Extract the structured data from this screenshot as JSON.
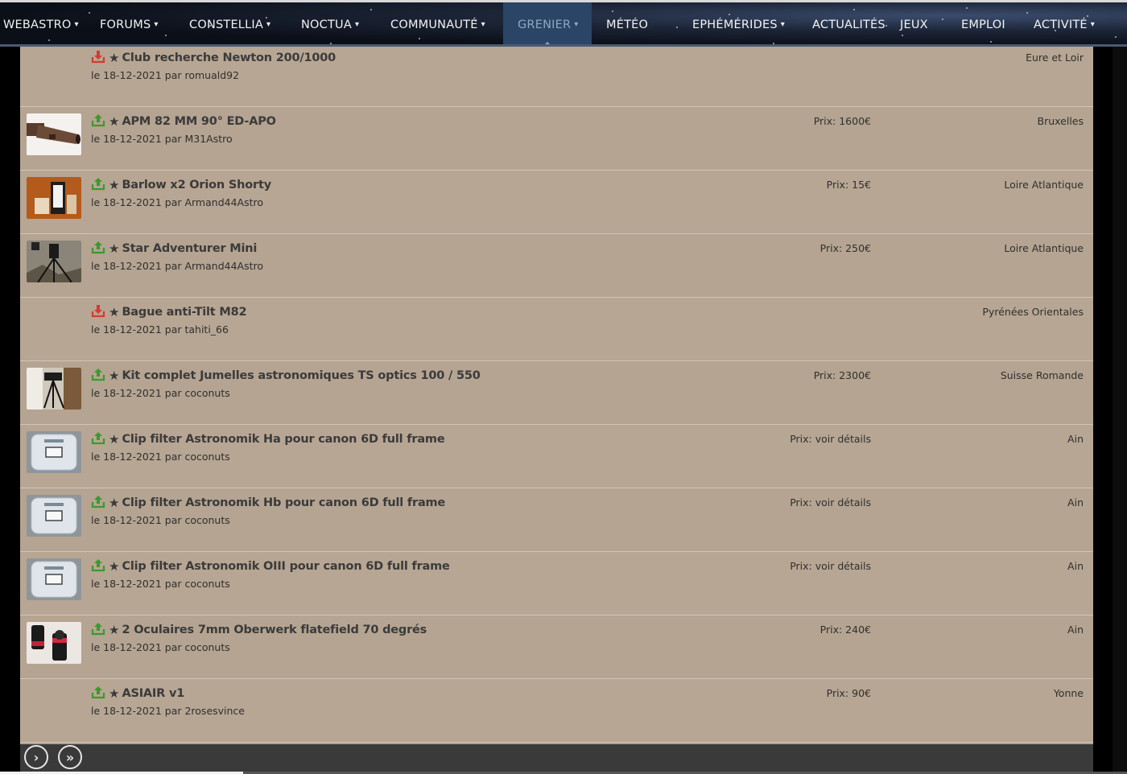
{
  "nav": {
    "items": [
      {
        "label": "WEBASTRO",
        "caret": true,
        "active": false
      },
      {
        "label": "FORUMS",
        "caret": true,
        "active": false
      },
      {
        "label": "CONSTELLIA",
        "caret": true,
        "active": false
      },
      {
        "label": "NOCTUA",
        "caret": true,
        "active": false
      },
      {
        "label": "COMMUNAUTÉ",
        "caret": true,
        "active": false
      },
      {
        "label": "GRENIER",
        "caret": true,
        "active": true
      },
      {
        "label": "MÉTÉO",
        "caret": false,
        "active": false
      },
      {
        "label": "EPHÉMÉRIDES",
        "caret": true,
        "active": false
      },
      {
        "label": "ACTUALITÉS",
        "caret": false,
        "active": false
      },
      {
        "label": "JEUX",
        "caret": false,
        "active": false
      },
      {
        "label": "EMPLOI",
        "caret": false,
        "active": false
      },
      {
        "label": "ACTIVITÉ",
        "caret": true,
        "active": false
      }
    ],
    "caret_glyph": "▾"
  },
  "listings": [
    {
      "kind": "wanted",
      "thumb": "",
      "title": "Club recherche Newton 200/1000",
      "meta": "le 18-12-2021 par romuald92",
      "price": "",
      "location": "Eure et Loir"
    },
    {
      "kind": "offer",
      "thumb": "refractor",
      "title": "APM 82 MM 90° ED-APO",
      "meta": "le 18-12-2021 par M31Astro",
      "price": "Prix: 1600€",
      "location": "Bruxelles"
    },
    {
      "kind": "offer",
      "thumb": "barlow",
      "title": "Barlow x2 Orion Shorty",
      "meta": "le 18-12-2021 par Armand44Astro",
      "price": "Prix: 15€",
      "location": "Loire Atlantique"
    },
    {
      "kind": "offer",
      "thumb": "mount",
      "title": "Star Adventurer Mini",
      "meta": "le 18-12-2021 par Armand44Astro",
      "price": "Prix: 250€",
      "location": "Loire Atlantique"
    },
    {
      "kind": "wanted",
      "thumb": "",
      "title": "Bague anti-Tilt M82",
      "meta": "le 18-12-2021 par tahiti_66",
      "price": "",
      "location": "Pyrénées Orientales"
    },
    {
      "kind": "offer",
      "thumb": "tripod",
      "title": "Kit complet Jumelles astronomiques TS optics 100 / 550",
      "meta": "le 18-12-2021 par coconuts",
      "price": "Prix: 2300€",
      "location": "Suisse Romande"
    },
    {
      "kind": "offer",
      "thumb": "filter",
      "title": "Clip filter Astronomik Ha pour canon 6D full frame",
      "meta": "le 18-12-2021 par coconuts",
      "price": "Prix: voir détails",
      "location": "Ain"
    },
    {
      "kind": "offer",
      "thumb": "filter",
      "title": "Clip filter Astronomik Hb pour canon 6D full frame",
      "meta": "le 18-12-2021 par coconuts",
      "price": "Prix: voir détails",
      "location": "Ain"
    },
    {
      "kind": "offer",
      "thumb": "filter",
      "title": "Clip filter Astronomik OIII pour canon 6D full frame",
      "meta": "le 18-12-2021 par coconuts",
      "price": "Prix: voir détails",
      "location": "Ain"
    },
    {
      "kind": "offer",
      "thumb": "eyepiece",
      "title": "2 Oculaires 7mm Oberwerk flatefield 70 degrés",
      "meta": "le 18-12-2021 par coconuts",
      "price": "Prix: 240€",
      "location": "Ain"
    },
    {
      "kind": "offer",
      "thumb": "",
      "title": "ASIAIR v1",
      "meta": "le 18-12-2021 par 2rosesvince",
      "price": "Prix: 90€",
      "location": "Yonne"
    }
  ],
  "icons": {
    "offer": "upload-icon",
    "wanted": "download-icon",
    "favorite": "star-icon",
    "offer_color": "#3a9a2c",
    "wanted_color": "#d63a2f"
  },
  "pager": {
    "next_glyph": "›",
    "last_glyph": "»"
  }
}
